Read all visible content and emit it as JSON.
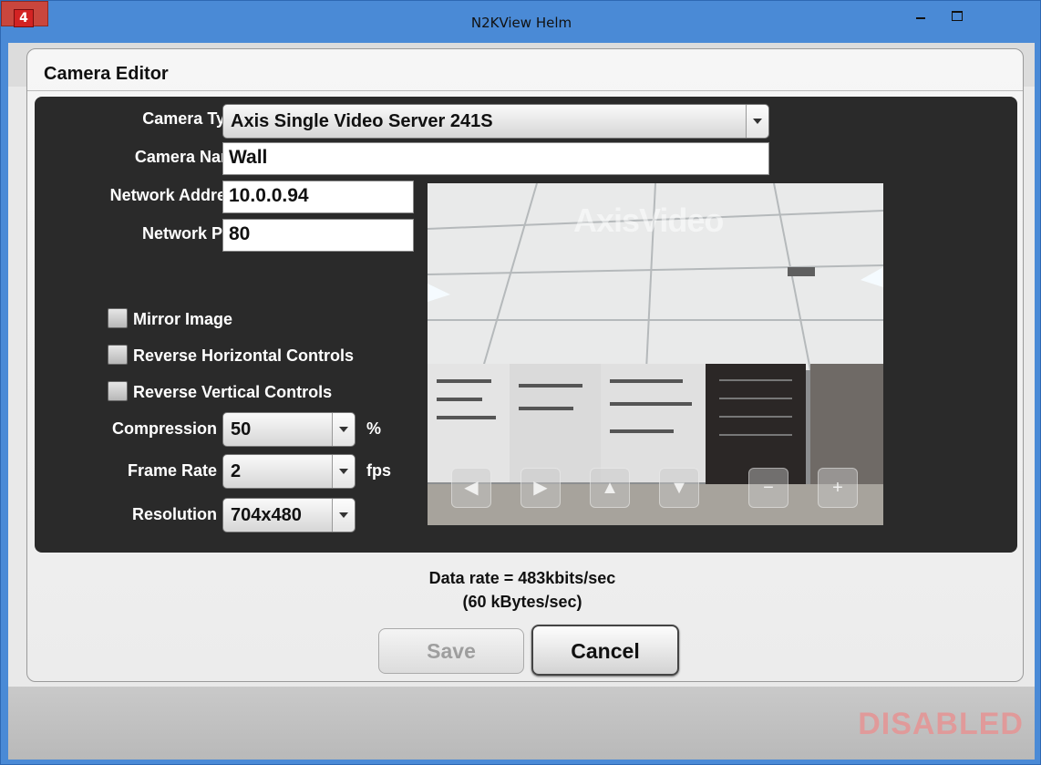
{
  "window": {
    "title": "N2KView Helm",
    "close_glyph": "×"
  },
  "editor": {
    "title": "Camera Editor",
    "camera_type": {
      "label": "Camera Type",
      "value": "Axis Single Video Server 241S"
    },
    "camera_name": {
      "label": "Camera Name",
      "value": "Wall"
    },
    "network_address": {
      "label": "Network Address",
      "value": "10.0.0.94"
    },
    "network_port": {
      "label": "Network Port",
      "value": "80"
    },
    "checkboxes": [
      {
        "label": "Mirror Image",
        "checked": false
      },
      {
        "label": "Reverse Horizontal Controls",
        "checked": false
      },
      {
        "label": "Reverse Vertical Controls",
        "checked": false
      }
    ],
    "compression": {
      "label": "Compression",
      "value": "50",
      "unit": "%"
    },
    "frame_rate": {
      "label": "Frame Rate",
      "value": "2",
      "unit": "fps"
    },
    "resolution": {
      "label": "Resolution",
      "value": "704x480"
    },
    "preview": {
      "watermark": "AxisVideo",
      "controls": [
        "pan-left-icon",
        "pan-right-icon",
        "tilt-up-icon",
        "tilt-down-icon",
        "zoom-out-icon",
        "zoom-in-icon"
      ]
    },
    "data_rate_line1": "Data rate = 483kbits/sec",
    "data_rate_line2": "(60 kBytes/sec)",
    "save_label": "Save",
    "cancel_label": "Cancel"
  },
  "status": {
    "disabled_text": "DISABLED"
  },
  "colors": {
    "title_bar": "#4a8ad6",
    "close": "#c9463d",
    "panel": "#2a2a2a",
    "disabled": "#e09a9a"
  }
}
